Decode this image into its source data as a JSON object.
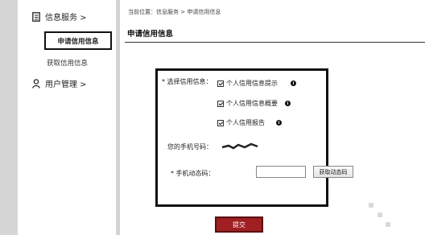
{
  "sidebar": {
    "info_service": "信息服务 >",
    "apply_credit": "申请信用信息",
    "get_credit": "获取信用信息",
    "user_manage": "用户管理 >"
  },
  "main": {
    "breadcrumb": "当前位置：信息服务 > 申请信用信息",
    "title": "申请信用信息",
    "select_label": "* 选择信用信息：",
    "options": [
      {
        "label": "个人信用信息提示",
        "checked": true
      },
      {
        "label": "个人信用信息概要",
        "checked": true
      },
      {
        "label": "个人信用报告",
        "checked": true
      }
    ],
    "phone_label": "您的手机号码：",
    "code_label": "* 手机动态码：",
    "code_value": "",
    "get_code_label": "获取动态码",
    "submit_label": "提交"
  }
}
